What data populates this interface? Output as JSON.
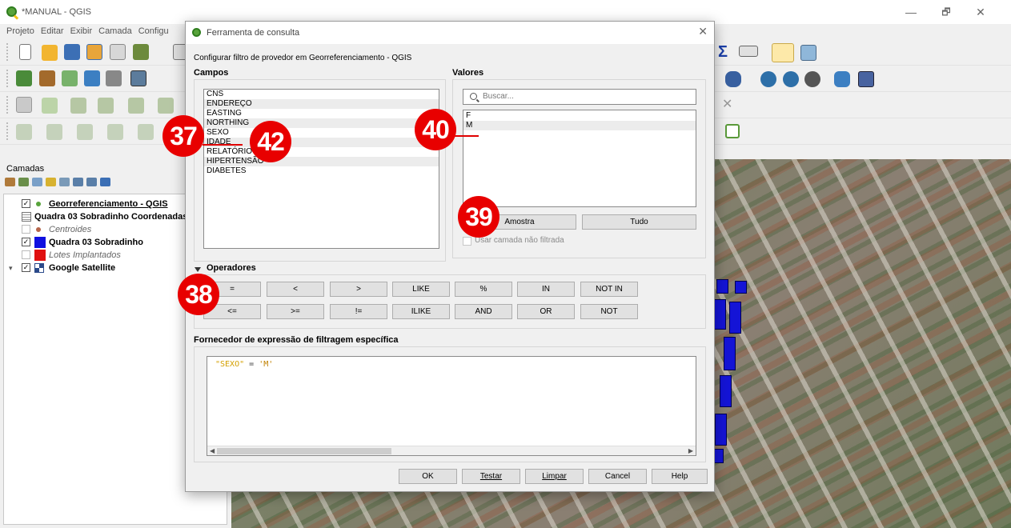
{
  "window": {
    "title": "*MANUAL - QGIS",
    "minimize": "—",
    "restore": "🗗",
    "close": "✕"
  },
  "menu": [
    "Projeto",
    "Editar",
    "Exibir",
    "Camada",
    "Configu"
  ],
  "layers_panel": {
    "title": "Camadas",
    "layers": [
      {
        "name": "Georreferenciamento - QGIS",
        "checked": true,
        "style": "bold-underline",
        "swatch": "#58a33b"
      },
      {
        "name": "Quadra 03 Sobradinho Coordenadas",
        "checked": null,
        "style": "bold",
        "swatch": "table"
      },
      {
        "name": "Centroides",
        "checked": false,
        "style": "italic",
        "swatch": "#b5654a"
      },
      {
        "name": "Quadra 03 Sobradinho",
        "checked": true,
        "style": "bold",
        "swatch": "#1010e0"
      },
      {
        "name": "Lotes Implantados",
        "checked": false,
        "style": "italic",
        "swatch": "#e01010"
      },
      {
        "name": "Google Satellite",
        "checked": true,
        "style": "bold",
        "swatch": "raster"
      }
    ]
  },
  "dialog": {
    "title": "Ferramenta de consulta",
    "subtitle": "Configurar filtro de provedor em Georreferenciamento - QGIS",
    "fields_label": "Campos",
    "fields": [
      "CNS",
      "ENDEREÇO",
      "EASTING",
      "NORTHING",
      "SEXO",
      "IDADE",
      "RELATÓRIO RISCO",
      "HIPERTENSÃO",
      "DIABETES"
    ],
    "values_label": "Valores",
    "search_placeholder": "Buscar...",
    "values": [
      "F",
      "M"
    ],
    "sample_button": "Amostra",
    "all_button": "Tudo",
    "use_unfiltered": "Usar camada não filtrada",
    "operators_label": "Operadores",
    "operators_row1": [
      "=",
      "<",
      ">",
      "LIKE",
      "%",
      "IN",
      "NOT IN"
    ],
    "operators_row2": [
      "<=",
      ">=",
      "!=",
      "ILIKE",
      "AND",
      "OR",
      "NOT"
    ],
    "expression_label": "Fornecedor de expressão de filtragem específica",
    "expression": {
      "field": "\"SEXO\"",
      "operator": " = ",
      "value": "'M'"
    },
    "buttons": {
      "ok": "OK",
      "test": "Testar",
      "clear": "Limpar",
      "cancel": "Cancel",
      "help": "Help"
    }
  },
  "annotations": {
    "a37": "37",
    "a42": "42",
    "a40": "40",
    "a39": "39",
    "a38": "38"
  }
}
